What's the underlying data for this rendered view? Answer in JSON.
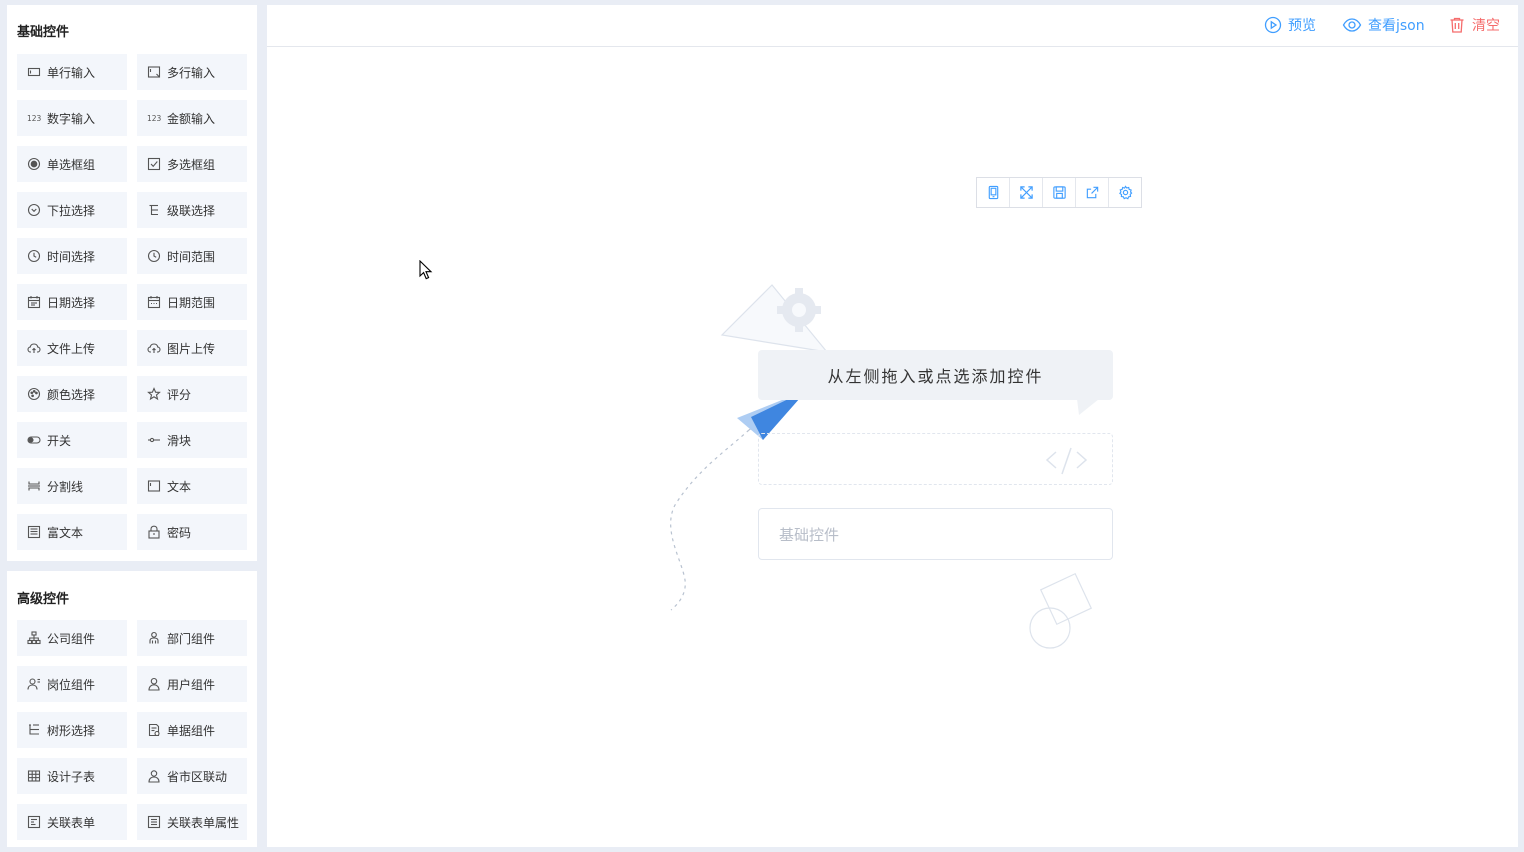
{
  "basic": {
    "title": "基础控件",
    "items": [
      {
        "label": "单行输入",
        "icon": "single-line-input-icon"
      },
      {
        "label": "多行输入",
        "icon": "multi-line-input-icon"
      },
      {
        "label": "数字输入",
        "icon": "number-input-icon"
      },
      {
        "label": "金额输入",
        "icon": "amount-input-icon"
      },
      {
        "label": "单选框组",
        "icon": "radio-icon"
      },
      {
        "label": "多选框组",
        "icon": "checkbox-icon"
      },
      {
        "label": "下拉选择",
        "icon": "dropdown-icon"
      },
      {
        "label": "级联选择",
        "icon": "cascade-icon"
      },
      {
        "label": "时间选择",
        "icon": "clock-icon"
      },
      {
        "label": "时间范围",
        "icon": "time-range-icon"
      },
      {
        "label": "日期选择",
        "icon": "calendar-icon"
      },
      {
        "label": "日期范围",
        "icon": "date-range-icon"
      },
      {
        "label": "文件上传",
        "icon": "cloud-upload-icon"
      },
      {
        "label": "图片上传",
        "icon": "image-upload-icon"
      },
      {
        "label": "颜色选择",
        "icon": "palette-icon"
      },
      {
        "label": "评分",
        "icon": "star-icon"
      },
      {
        "label": "开关",
        "icon": "toggle-icon"
      },
      {
        "label": "滑块",
        "icon": "slider-icon"
      },
      {
        "label": "分割线",
        "icon": "divider-icon"
      },
      {
        "label": "文本",
        "icon": "text-icon"
      },
      {
        "label": "富文本",
        "icon": "rich-text-icon"
      },
      {
        "label": "密码",
        "icon": "lock-icon"
      }
    ]
  },
  "advanced": {
    "title": "高级控件",
    "items": [
      {
        "label": "公司组件",
        "icon": "org-tree-icon"
      },
      {
        "label": "部门组件",
        "icon": "department-icon"
      },
      {
        "label": "岗位组件",
        "icon": "position-icon"
      },
      {
        "label": "用户组件",
        "icon": "user-icon"
      },
      {
        "label": "树形选择",
        "icon": "tree-icon"
      },
      {
        "label": "单据组件",
        "icon": "document-icon"
      },
      {
        "label": "设计子表",
        "icon": "table-icon"
      },
      {
        "label": "省市区联动",
        "icon": "location-user-icon"
      },
      {
        "label": "关联表单",
        "icon": "form-link-icon"
      },
      {
        "label": "关联表单属性",
        "icon": "form-attr-icon"
      }
    ]
  },
  "toolbar": {
    "preview": "预览",
    "view_json": "查看json",
    "clear": "清空",
    "accent": "#409eff",
    "danger": "#f56c6c"
  },
  "mini_toolbar": [
    "mobile-icon",
    "fullscreen-icon",
    "save-icon",
    "export-icon",
    "settings-icon"
  ],
  "empty_state": {
    "message": "从左侧拖入或点选添加控件",
    "placeholder": "基础控件"
  }
}
